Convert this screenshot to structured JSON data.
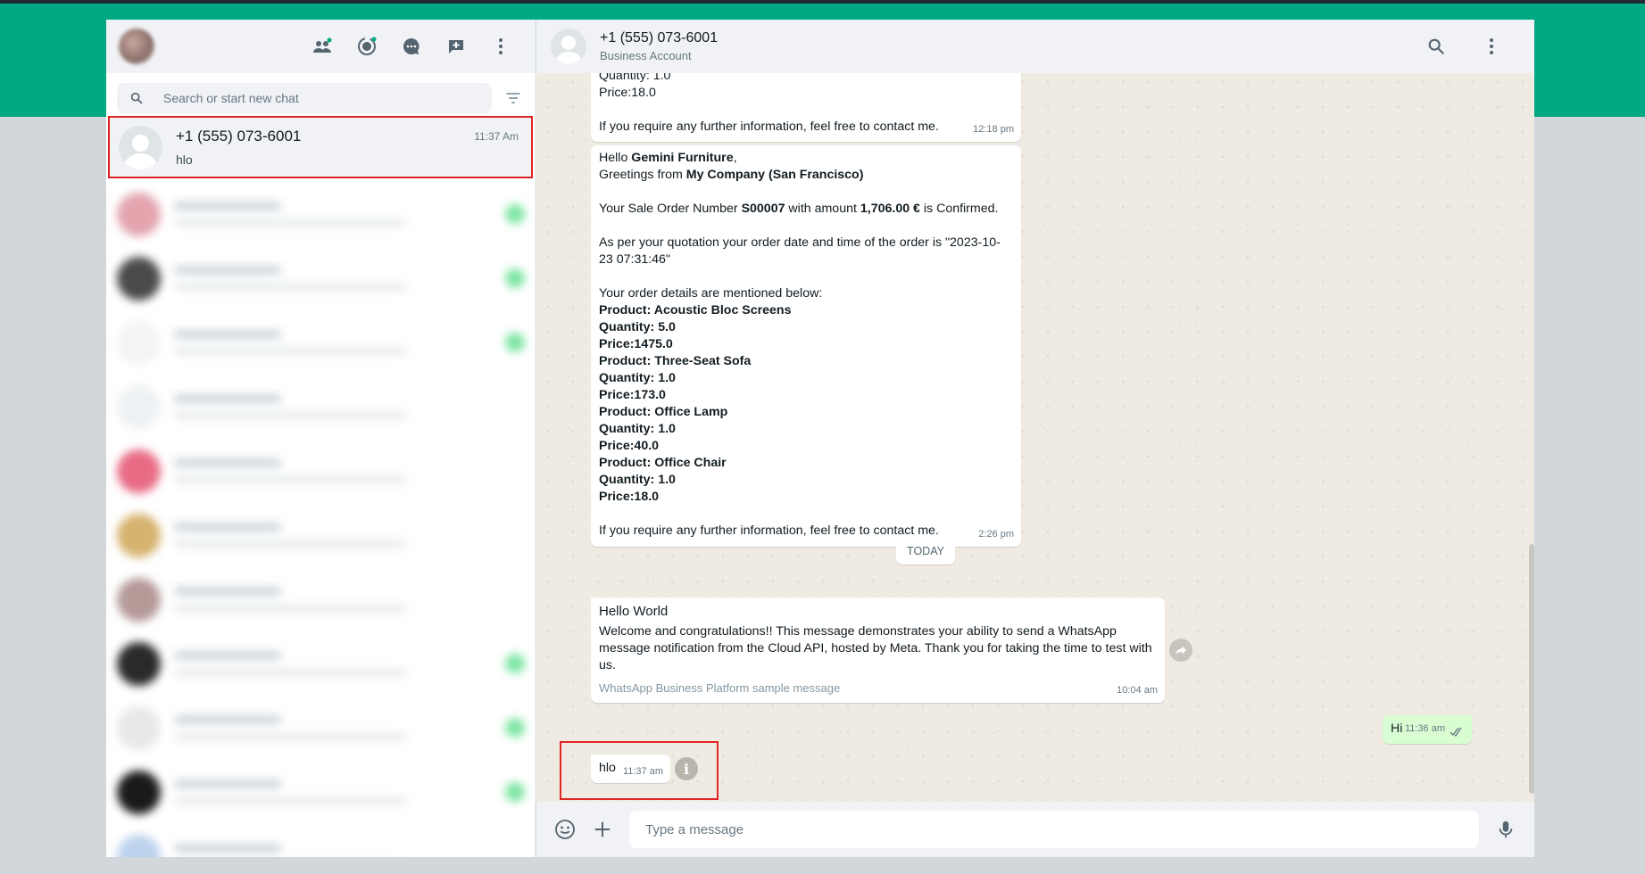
{
  "sidebar": {
    "search_placeholder": "Search or start new chat",
    "selected_chat": {
      "name": "+1 (555) 073-6001",
      "time": "11:37 Am",
      "last_message": "hlo"
    }
  },
  "header": {
    "contact_name": "+1 (555) 073-6001",
    "contact_status": "Business Account"
  },
  "messages": {
    "m1": {
      "text": "Quantity: 1.0\nPrice:18.0\n\nIf you require any further information, feel free to contact me.",
      "time": "12:18 pm"
    },
    "m2": {
      "greeting_prefix": "Hello ",
      "customer": "Gemini Furniture",
      "greeting_suffix": ",",
      "greetings_prefix": "Greetings from ",
      "company": "My Company (San Francisco)",
      "order_prefix": "Your Sale Order Number ",
      "order_no": "S00007",
      "order_mid": " with amount ",
      "amount": "1,706.00 €",
      "order_suffix": " is Confirmed.",
      "date_line": "As per your quotation your order date and time of the order is \"2023-10-23 07:31:46\"",
      "details_intro": "Your order details are mentioned below:",
      "items": [
        {
          "product": "Product: Acoustic Bloc Screens",
          "qty": "Quantity: 5.0",
          "price": "Price:1475.0"
        },
        {
          "product": "Product: Three-Seat Sofa",
          "qty": "Quantity: 1.0",
          "price": "Price:173.0"
        },
        {
          "product": "Product: Office Lamp",
          "qty": "Quantity: 1.0",
          "price": "Price:40.0"
        },
        {
          "product": "Product: Office Chair",
          "qty": "Quantity: 1.0",
          "price": "Price:18.0"
        }
      ],
      "closing": "If you require any further information, feel free to contact me.",
      "time": "2:26 pm"
    },
    "day_divider": "TODAY",
    "m3": {
      "title": "Hello World",
      "body": "Welcome and congratulations!! This message demonstrates your ability to send a WhatsApp message notification from the Cloud API, hosted by Meta. Thank you for taking the time to test with us.",
      "footer": "WhatsApp Business Platform sample message",
      "time": "10:04 am"
    },
    "m4": {
      "text": "Hi",
      "time": "11:36 am"
    },
    "m5": {
      "text": "hlo",
      "time": "11:37 am"
    }
  },
  "composer": {
    "placeholder": "Type a message"
  },
  "icons": [
    "communities-icon",
    "status-icon",
    "channels-icon",
    "new-chat-icon",
    "menu-icon",
    "search-icon",
    "filter-icon",
    "emoji-icon",
    "attach-icon",
    "mic-icon",
    "forward-icon",
    "info-icon"
  ],
  "colors": {
    "accent": "#00a884",
    "highlight": "#e02424",
    "outgoing": "#d9fdd3"
  }
}
